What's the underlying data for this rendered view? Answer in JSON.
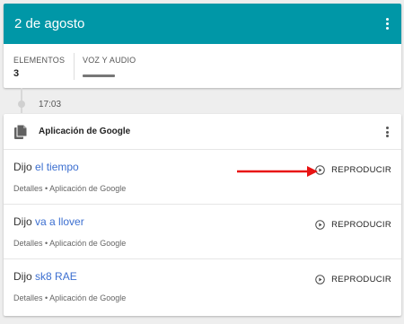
{
  "day": {
    "date": "2 de agosto",
    "stats": {
      "items_label": "ELEMENTOS",
      "items_value": "3",
      "voice_label": "VOZ Y AUDIO"
    }
  },
  "timeline": {
    "time": "17:03"
  },
  "activity": {
    "title": "Aplicación de Google",
    "entries": [
      {
        "prefix": "Dijo",
        "query": "el tiempo",
        "detail": "Detalles • Aplicación de Google",
        "action": "REPRODUCIR"
      },
      {
        "prefix": "Dijo",
        "query": "va a llover",
        "detail": "Detalles • Aplicación de Google",
        "action": "REPRODUCIR"
      },
      {
        "prefix": "Dijo",
        "query": "sk8 RAE",
        "detail": "Detalles • Aplicación de Google",
        "action": "REPRODUCIR"
      }
    ]
  },
  "colors": {
    "header_bg": "#0097a7",
    "query_link": "#3c6fd0",
    "annotation_arrow": "#e81313",
    "page_bg": "#eeeeee"
  },
  "icons": [
    "more-vert-icon",
    "document-icon",
    "play-circle-icon"
  ]
}
